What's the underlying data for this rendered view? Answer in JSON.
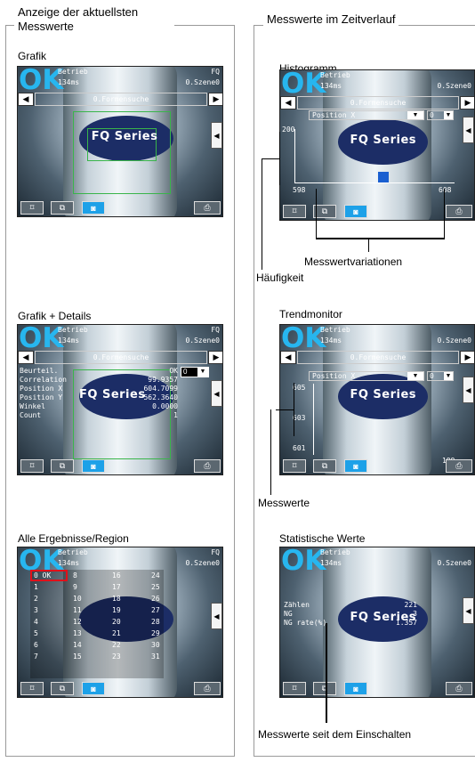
{
  "left_column": {
    "title": "Anzeige der aktuellsten Messwerte"
  },
  "right_column": {
    "title": "Messwerte im Zeitverlauf"
  },
  "device": {
    "result": "OK",
    "status": "Betrieb",
    "time": "134ms",
    "scene": "0.Szene0",
    "product": "FQ",
    "label_text": "FQ Series",
    "nav_left": "◀",
    "nav_right": "▶",
    "side_tab": "◀",
    "toolbar_icons": [
      "frame-icon",
      "zoom-icon",
      "camera-icon",
      "print-icon"
    ]
  },
  "screens": {
    "grafik": {
      "label": "Grafik",
      "nav_title": "0.Formensuche"
    },
    "grafik_details": {
      "label": "Grafik + Details",
      "nav_title": "0.Formensuche",
      "rows": [
        {
          "name": "Beurteil.",
          "value": "OK"
        },
        {
          "name": "Correlation",
          "value": "99.9357"
        },
        {
          "name": "Position X",
          "value": "604.7099"
        },
        {
          "name": "Position Y",
          "value": "562.3640"
        },
        {
          "name": "Winkel",
          "value": "0.0000"
        },
        {
          "name": "Count",
          "value": "1"
        }
      ],
      "select_value": "0"
    },
    "alle": {
      "label": "Alle Ergebnisse/Region",
      "first_item": "0  OK",
      "col1": [
        "1",
        "2",
        "3",
        "4",
        "5",
        "6",
        "7"
      ],
      "col2": [
        "8",
        "9",
        "10",
        "11",
        "12",
        "13",
        "14",
        "15"
      ],
      "col3": [
        "16",
        "17",
        "18",
        "19",
        "20",
        "21",
        "22",
        "23"
      ],
      "col4": [
        "24",
        "25",
        "26",
        "27",
        "28",
        "29",
        "30",
        "31"
      ]
    },
    "histogramm": {
      "label": "Histogramm",
      "nav_title": "0.Formensuche",
      "dropdown": "Position X",
      "select_value": "0",
      "y_tick": "200",
      "x_min": "598",
      "x_max": "608",
      "callout_variationen": "Messwertvariationen",
      "callout_haeufigkeit": "Häufigkeit"
    },
    "trend": {
      "label": "Trendmonitor",
      "nav_title": "0.Formensuche",
      "dropdown": "Position X",
      "select_value": "0",
      "y_ticks": [
        "605",
        "603",
        "601"
      ],
      "x_last": "199",
      "callout": "Messwerte"
    },
    "statistik": {
      "label": "Statistische Werte",
      "rows": [
        {
          "name": "Zählen",
          "value": "221"
        },
        {
          "name": "NG",
          "value": "3"
        },
        {
          "name": "NG rate(%)",
          "value": "1.357"
        }
      ],
      "callout": "Messwerte seit dem Einschalten"
    }
  },
  "colors": {
    "ok": "#27b6ef",
    "accent": "#1da1e8",
    "region": "#39b54a",
    "selected": "#e0101a"
  }
}
